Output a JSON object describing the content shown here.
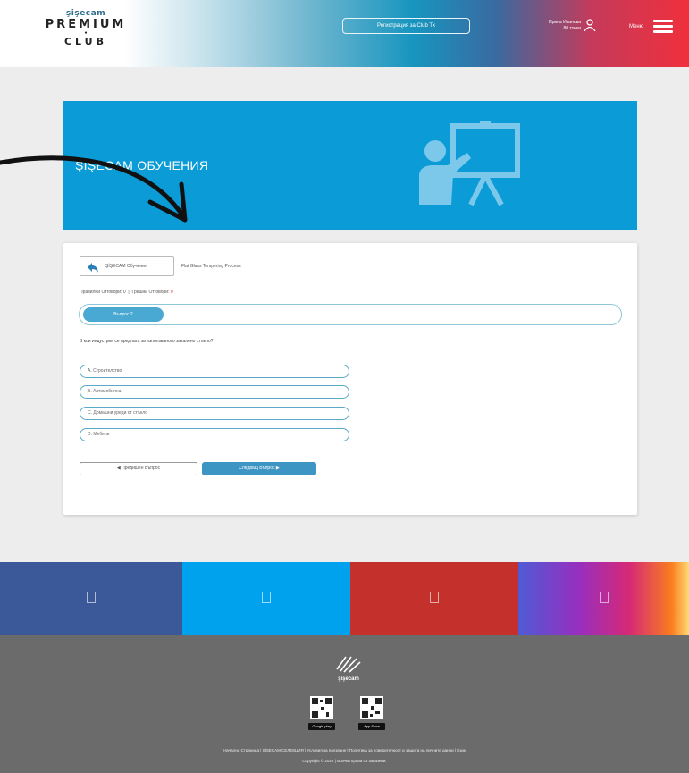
{
  "header": {
    "logo_brand": "şişecam",
    "logo_premium": "PREMIUM",
    "logo_club": "CLUB",
    "center_button": "Регистрация за Club Tx",
    "user_line1": "Ирина Иванова",
    "user_line2": "80 точки",
    "menu_label": "Меню"
  },
  "banner": {
    "title": "ŞİŞECAM ОБУЧЕНИЯ",
    "color": "#0b9cd7"
  },
  "quiz": {
    "back_label": "ŞİŞECAM Обучения",
    "breadcrumb": "Flat Glass Tempering Process",
    "score_correct_label": "Правилни Отговори:",
    "score_correct": "0",
    "score_wrong_label": "Грешни Отговори:",
    "score_wrong": "0",
    "progress_label": "Въпрос 2",
    "question": "В кои индустрии се предлага за използваното закалено стъкло?",
    "answers": [
      "A. Строителство",
      "B. Автомобилна",
      "C. Домашни уреди от стъкло",
      "D. Мебели"
    ],
    "prev_button": "Предишен Въпрос",
    "next_button": "Следващ Въпрос"
  },
  "strip": {
    "colors": [
      "#3b5998",
      "#00a2ed",
      "#c4302b",
      "gradient"
    ]
  },
  "footer": {
    "logo_text": "şişecam",
    "google_play": "Google play",
    "app_store": "App Store",
    "links": "Начална Страница  |  ŞİŞECAM СЕЛЕКЦИЯ  |  Условия за ползване  |  Политика за поверителност и защита на личните данни  |  Език",
    "copyright": "Copyright © 2022 | Всички права са запазени."
  }
}
